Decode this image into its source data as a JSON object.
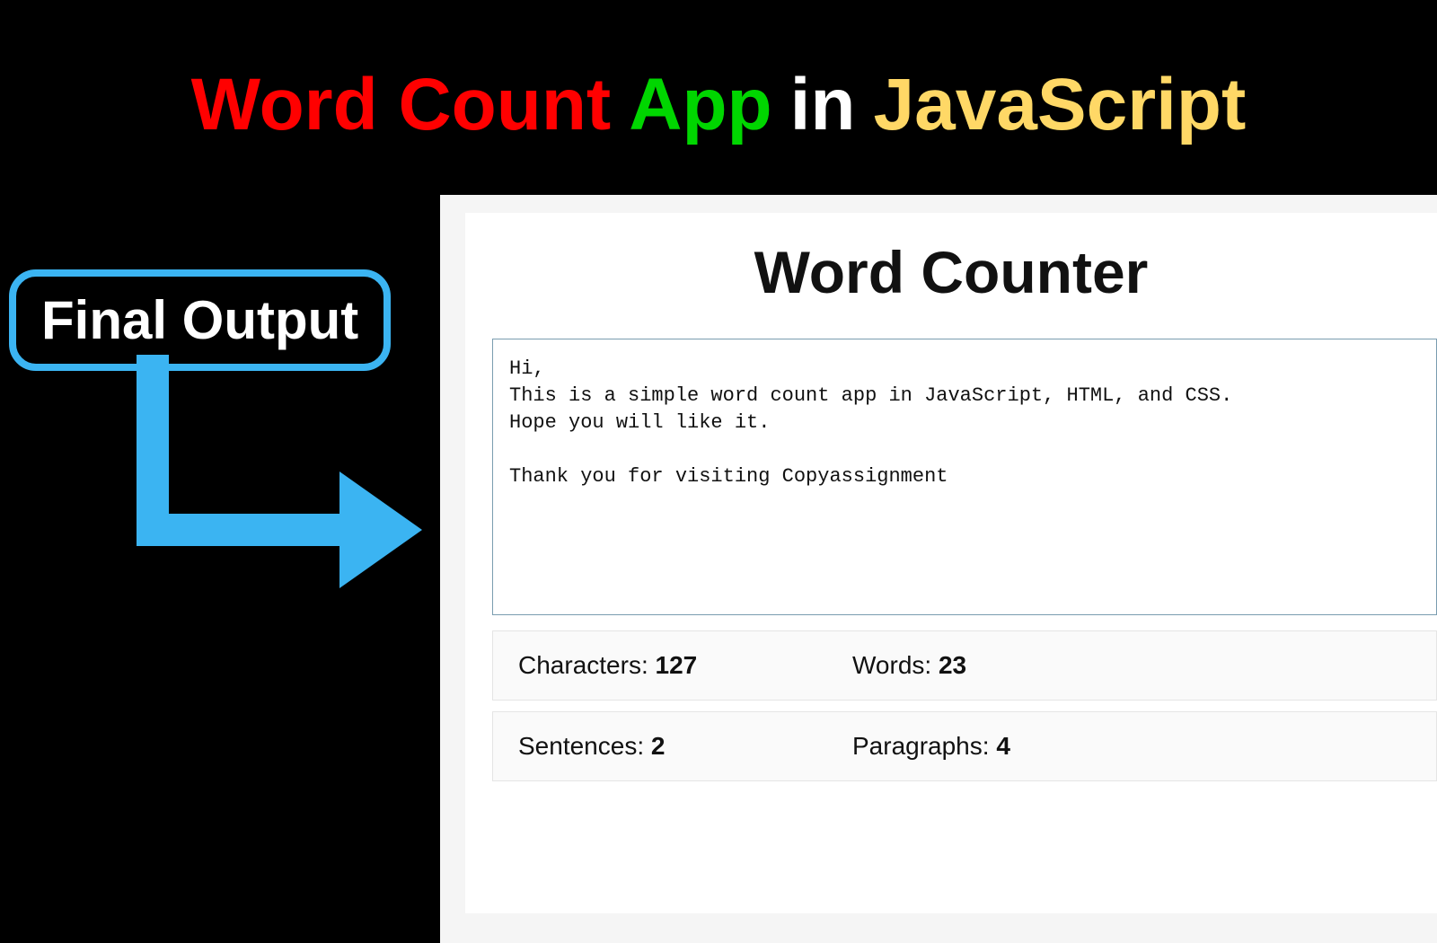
{
  "title": {
    "word_count": "Word Count",
    "app": "App",
    "in": "in",
    "javascript": "JavaScript"
  },
  "callout_label": "Final Output",
  "app": {
    "heading": "Word Counter",
    "textarea_value": "Hi,\nThis is a simple word count app in JavaScript, HTML, and CSS.\nHope you will like it.\n\nThank you for visiting Copyassignment",
    "stats": {
      "characters_label": "Characters: ",
      "characters_value": "127",
      "words_label": "Words: ",
      "words_value": "23",
      "sentences_label": "Sentences: ",
      "sentences_value": "2",
      "paragraphs_label": "Paragraphs: ",
      "paragraphs_value": "4"
    }
  }
}
